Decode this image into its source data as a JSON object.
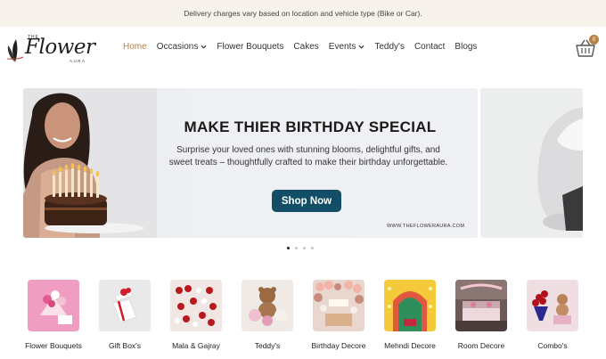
{
  "announcement": "Delivery charges vary based on location and vehicle type (Bike or Car).",
  "logo": {
    "the": "THE",
    "word": "Flower",
    "aura": "AURA"
  },
  "nav": [
    {
      "label": "Home"
    },
    {
      "label": "Occasions"
    },
    {
      "label": "Flower Bouquets"
    },
    {
      "label": "Cakes"
    },
    {
      "label": "Events"
    },
    {
      "label": "Teddy's"
    },
    {
      "label": "Contact"
    },
    {
      "label": "Blogs"
    }
  ],
  "cart": {
    "count": "0"
  },
  "banner": {
    "title": "MAKE THIER BIRTHDAY SPECIAL",
    "subtitle": "Surprise your loved ones with stunning blooms, delightful gifts, and sweet treats – thoughtfully crafted to make their birthday unforgettable.",
    "button": "Shop Now",
    "url": "WWW.THEFLOWERAURA.COM"
  },
  "slider": {
    "total": 4,
    "active": 1
  },
  "categories": [
    {
      "label": "Flower Bouquets"
    },
    {
      "label": "Gift Box's"
    },
    {
      "label": "Mala & Gajray"
    },
    {
      "label": "Teddy's"
    },
    {
      "label": "Birthday Decore"
    },
    {
      "label": "Mehndi Decore"
    },
    {
      "label": "Room Decore"
    },
    {
      "label": "Combo's"
    }
  ],
  "colors": {
    "accent": "#b5824a",
    "button": "#124e66",
    "topbar": "#f7f3ec"
  }
}
